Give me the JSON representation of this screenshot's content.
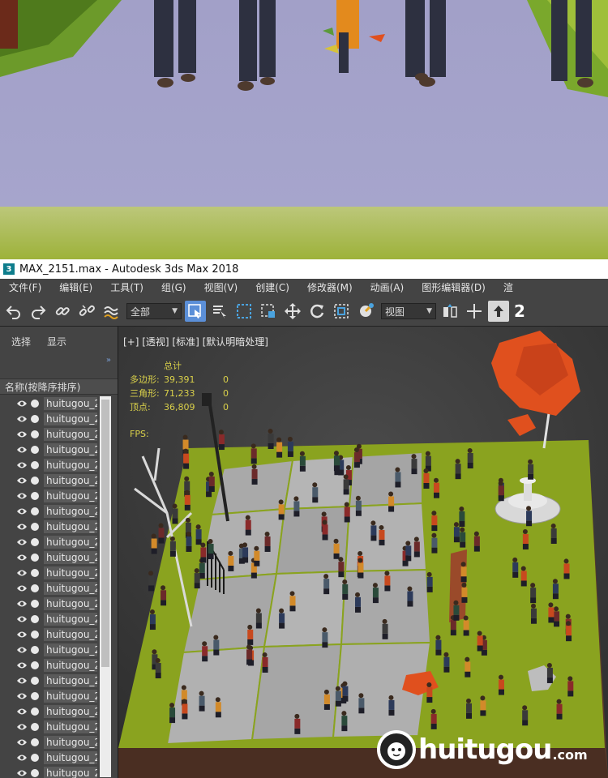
{
  "window": {
    "title": "MAX_2151.max - Autodesk 3ds Max 2018",
    "app_icon_glyph": "3"
  },
  "menu": [
    {
      "label": "文件(F)"
    },
    {
      "label": "编辑(E)"
    },
    {
      "label": "工具(T)"
    },
    {
      "label": "组(G)"
    },
    {
      "label": "视图(V)"
    },
    {
      "label": "创建(C)"
    },
    {
      "label": "修改器(M)"
    },
    {
      "label": "动画(A)"
    },
    {
      "label": "图形编辑器(D)"
    },
    {
      "label": "渲"
    }
  ],
  "toolbar": {
    "selection_filter": "全部",
    "reference_coord": "视图",
    "snap_label": "2",
    "icons": [
      "undo-icon",
      "redo-icon",
      "link-icon",
      "unlink-icon",
      "bind-spacewarp-icon",
      "select-object-icon",
      "select-by-name-icon",
      "rect-region-icon",
      "window-crossing-icon",
      "move-icon",
      "rotate-icon",
      "scale-icon",
      "place-icon",
      "mirror-icon",
      "axis-constraint-icon",
      "snap-toggle-icon"
    ]
  },
  "scene_explorer": {
    "tabs": [
      "选择",
      "显示"
    ],
    "column_header": "名称(按降序排序)",
    "items": [
      "huitugou_2",
      "huitugou_2",
      "huitugou_2",
      "huitugou_2",
      "huitugou_2",
      "huitugou_2",
      "huitugou_2",
      "huitugou_2",
      "huitugou_2",
      "huitugou_2",
      "huitugou_2",
      "huitugou_2",
      "huitugou_2",
      "huitugou_2",
      "huitugou_2",
      "huitugou_2",
      "huitugou_2",
      "huitugou_2",
      "huitugou_2",
      "huitugou_2",
      "huitugou_2",
      "huitugou_2",
      "huitugou_2",
      "huitugou_2",
      "huitugou_2"
    ]
  },
  "viewport": {
    "label": "[+] [透视] [标准] [默认明暗处理]",
    "stats": {
      "header": "总计",
      "rows": [
        {
          "label": "多边形:",
          "total": "39,391",
          "selected": "0"
        },
        {
          "label": "三角形:",
          "total": "71,233",
          "selected": "0"
        },
        {
          "label": "顶点:",
          "total": "36,809",
          "selected": "0"
        }
      ],
      "fps_label": "FPS:"
    }
  },
  "watermark": {
    "text": "huitugou",
    "suffix": ".com"
  },
  "colors": {
    "stats_text": "#d9d04a",
    "active_tool": "#5b8fd8",
    "grass": "#8aa31f",
    "ground": "#a9a9a9",
    "tree_foliage": "#e0501e"
  }
}
